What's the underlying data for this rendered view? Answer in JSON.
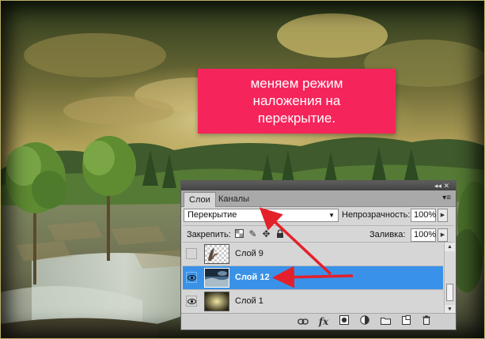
{
  "callout": {
    "text": "меняем режим\nналожения на\nперекрытие."
  },
  "layers_panel": {
    "tabs": [
      {
        "label": "Слои",
        "active": true
      },
      {
        "label": "Каналы",
        "active": false
      }
    ],
    "blend_mode": {
      "value": "Перекрытие"
    },
    "opacity": {
      "label": "Непрозрачность:",
      "value": "100%"
    },
    "lock": {
      "label": "Закрепить:",
      "icons": [
        "lock-transparent-icon",
        "lock-brush-icon",
        "lock-move-icon",
        "lock-all-icon"
      ]
    },
    "fill": {
      "label": "Заливка:",
      "value": "100%"
    },
    "layers": [
      {
        "name": "Слой 9",
        "visible": false,
        "selected": false
      },
      {
        "name": "Слой 12",
        "visible": true,
        "selected": true
      },
      {
        "name": "Слой 1",
        "visible": true,
        "selected": false
      }
    ],
    "footer_icons": [
      "link-icon",
      "fx-icon",
      "mask-icon",
      "adjustment-icon",
      "folder-icon",
      "new-layer-icon",
      "trash-icon"
    ]
  },
  "colors": {
    "callout_bg": "#f5255c",
    "arrow": "#e4202a",
    "selection": "#3a92e8"
  }
}
